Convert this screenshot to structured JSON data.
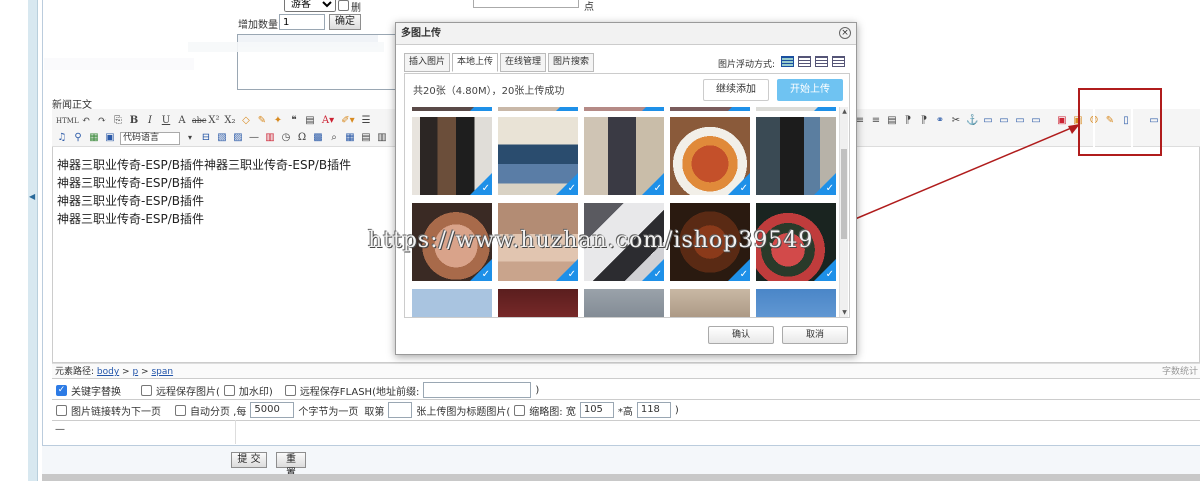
{
  "form": {
    "role_select": "游客",
    "delete_label": "删",
    "add_count_label": "增加数量:",
    "add_count_value": "1",
    "confirm_btn": "确定",
    "point_label": "点"
  },
  "editor": {
    "label": "新闻正文",
    "code_lang": "代码语言",
    "content_lines": [
      "神器三职业传奇-ESP/B插件神器三职业传奇-ESP/B插件",
      "神器三职业传奇-ESP/B插件",
      "神器三职业传奇-ESP/B插件",
      "神器三职业传奇-ESP/B插件"
    ],
    "path_label": "元素路径:",
    "path": [
      "body",
      "p",
      "span"
    ],
    "word_count": "字数统计"
  },
  "options": {
    "keyword_replace": "关键字替换",
    "remote_save_images": "远程保存图片(",
    "watermark": "加水印)",
    "remote_save_flash": "远程保存FLASH(地址前缀:",
    "close_paren": ")",
    "image_link_next": "图片链接转为下一页",
    "auto_paginate": "自动分页 ,每",
    "paginate_value": "5000",
    "chars_per_page": "个字节为一页",
    "take_nth": "取第",
    "nth_value": "",
    "as_title_image": "张上传图为标题图片(",
    "thumb_label": "缩略图: 宽",
    "thumb_width": "105",
    "thumb_height_label": "*高",
    "thumb_height": "118",
    "dash": "—"
  },
  "footer": {
    "submit": "提 交",
    "reset": "重置"
  },
  "watermark_text": "https://www.huzhan.com/ishop39549",
  "dialog": {
    "title": "多图上传",
    "tabs": [
      "插入图片",
      "本地上传",
      "在线管理",
      "图片搜索"
    ],
    "active_tab": "本地上传",
    "float_label": "图片浮动方式:",
    "summary": "共20张（4.80M），20张上传成功",
    "continue_btn": "继续添加",
    "start_btn": "开始上传",
    "ok_btn": "确认",
    "cancel_btn": "取消"
  },
  "colors": {
    "accent_blue": "#6fc3f2",
    "check_blue": "#1e90e8",
    "annotation_red": "#b01c1c"
  }
}
